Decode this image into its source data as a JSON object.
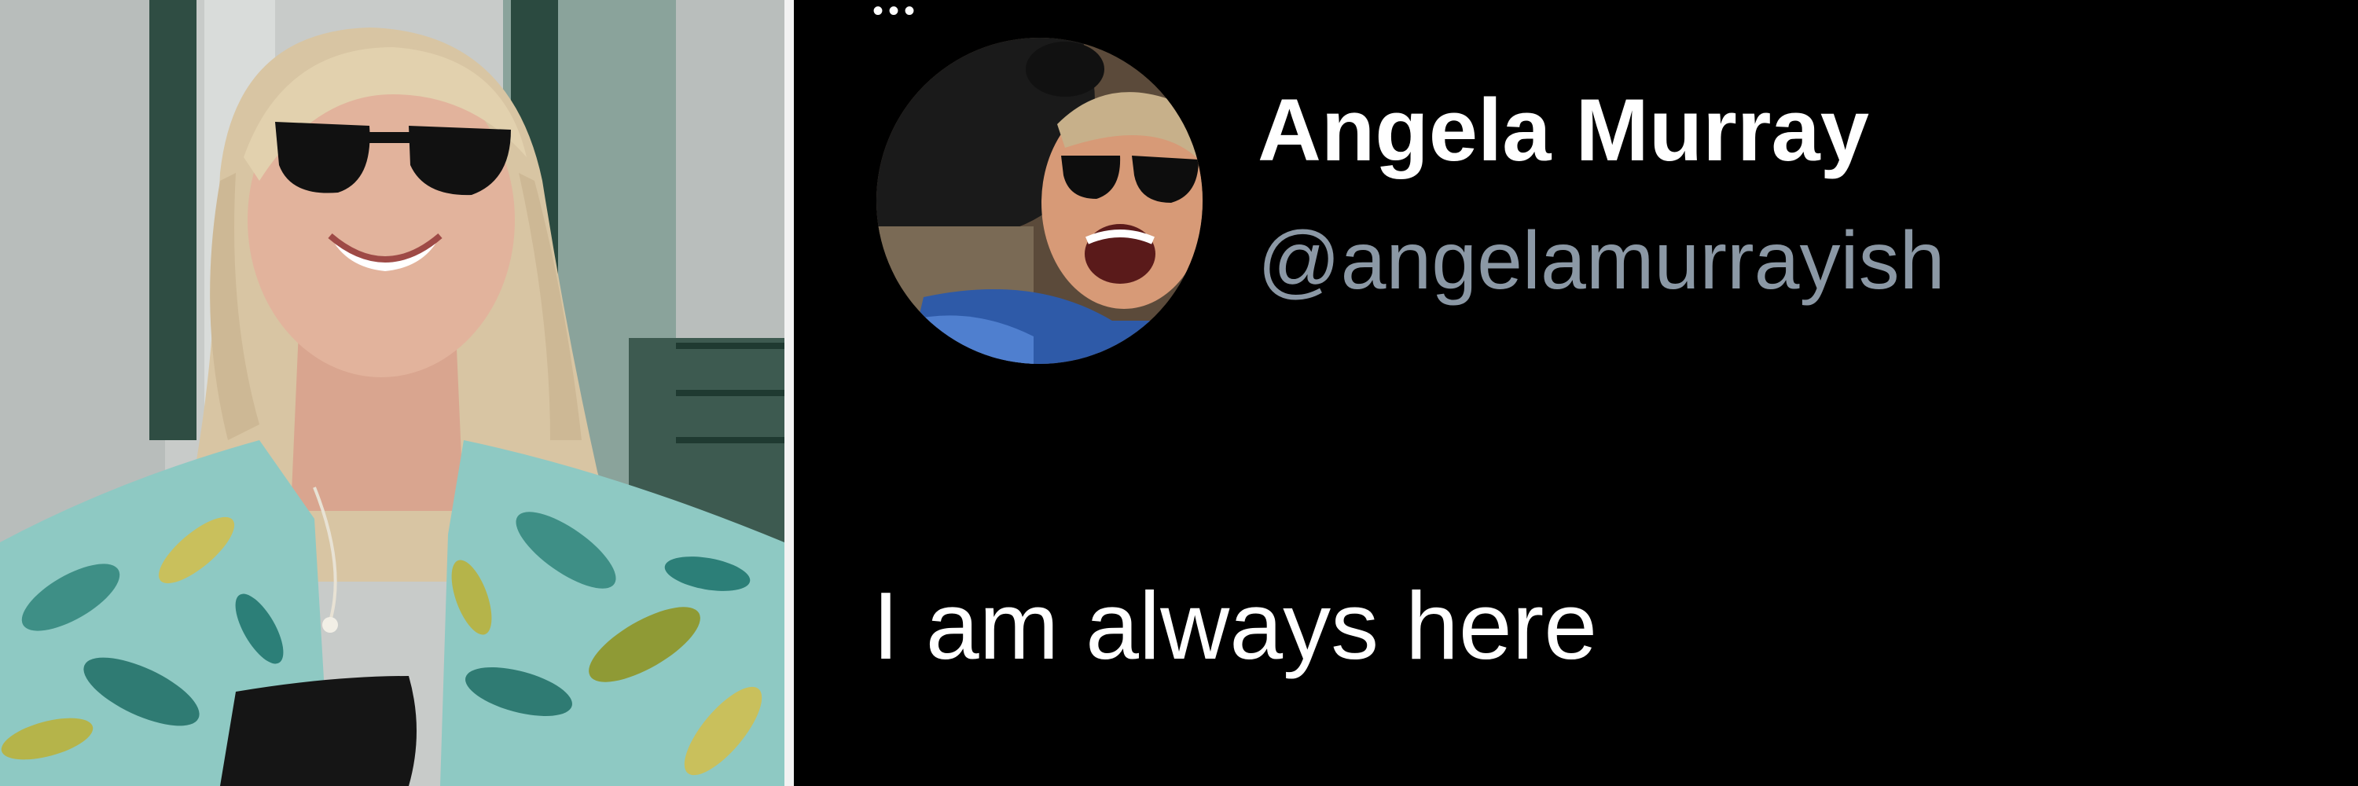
{
  "tweet": {
    "author": {
      "display_name": "Angela Murray",
      "handle": "@angelamurrayish"
    },
    "text": "I am always here"
  },
  "colors": {
    "background": "#000000",
    "name_text": "#ffffff",
    "handle_text": "#8b98a5",
    "body_text": "#ffffff"
  },
  "icons": [
    "ellipsis-icon"
  ]
}
